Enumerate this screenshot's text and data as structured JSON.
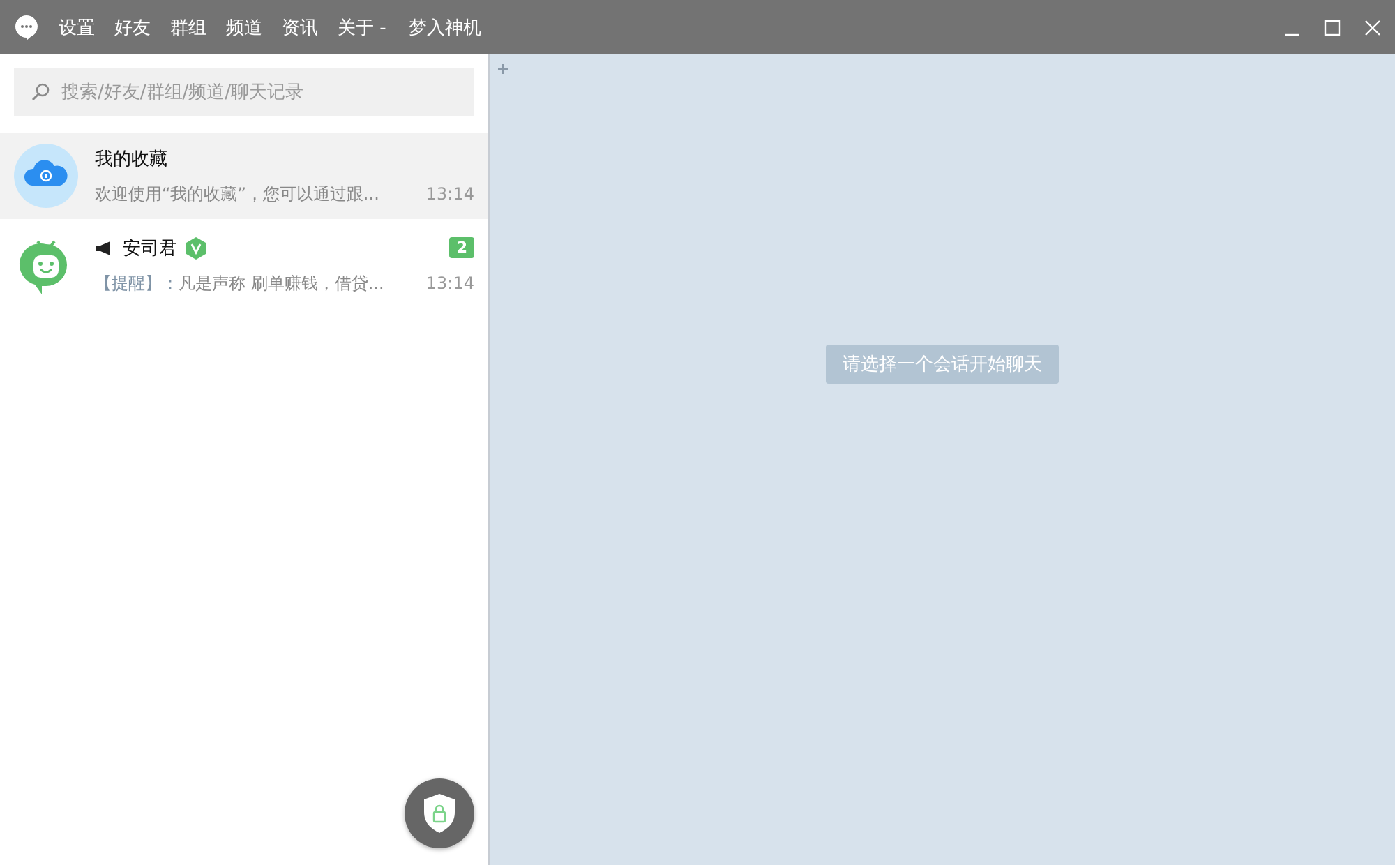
{
  "menu": [
    "设置",
    "好友",
    "群组",
    "频道",
    "资讯",
    "关于 -"
  ],
  "user_name": "梦入神机",
  "search": {
    "placeholder": "搜索/好友/群组/频道/聊天记录"
  },
  "conversations": [
    {
      "kind": "favorites",
      "name": "我的收藏",
      "preview": "欢迎使用“我的收藏”，您可以通过跟...",
      "time": "13:14",
      "selected": true,
      "announcement": false,
      "verified": false
    },
    {
      "kind": "bot",
      "name": "安司君",
      "preview_prefix": "【提醒】：",
      "preview": "凡是声称 刷单赚钱，借贷...",
      "time": "13:14",
      "selected": false,
      "announcement": true,
      "verified": true,
      "badge": "2"
    }
  ],
  "empty_hint": "请选择一个会话开始聊天"
}
